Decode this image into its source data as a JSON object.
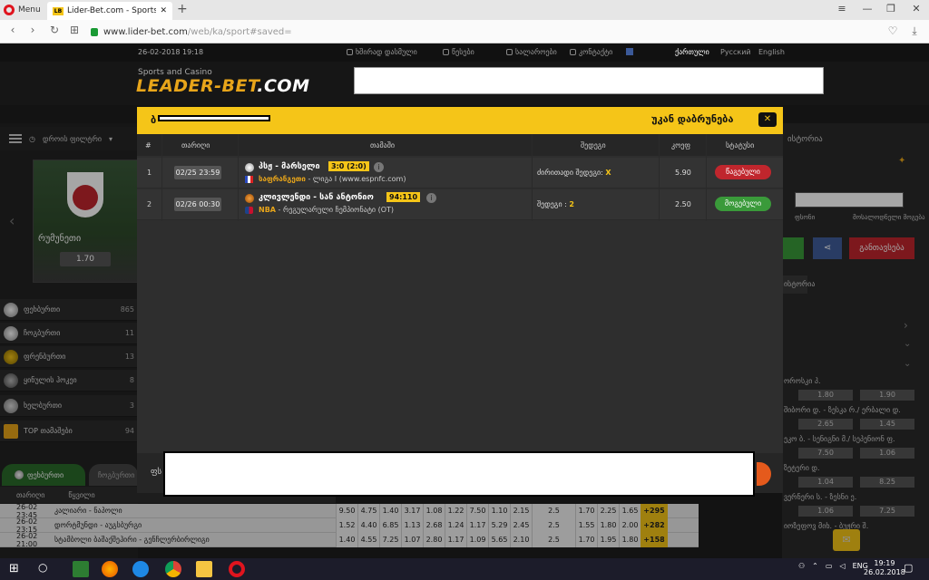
{
  "browser": {
    "menu_label": "Menu",
    "tab_title": "Lider-Bet.com - Sports an",
    "favicon": "LB",
    "url_host": "www.lider-bet.com",
    "url_path": "/web/ka/sport#saved="
  },
  "site": {
    "date": "26-02-2018 19:18",
    "toplinks": [
      "ხშირად დასმული",
      "წესები",
      "სალაროები",
      "კონტაქტი"
    ],
    "languages": [
      "ქართული",
      "Русский",
      "English"
    ],
    "sports_casino": "Sports and Casino",
    "logo_main": "LEADER-BET",
    "logo_dom": ".COM"
  },
  "left": {
    "filter_label": "დროის ფილტრი",
    "banner_team": "რუმუნეთი",
    "banner_odd": "1.70",
    "sports": [
      {
        "label": "ფეხბურთი",
        "count": "865"
      },
      {
        "label": "ჩოგბურთი",
        "count": "11"
      },
      {
        "label": "ფრენბურთი",
        "count": "13"
      },
      {
        "label": "ყინულის ჰოკეი",
        "count": "8"
      },
      {
        "label": "ხელბურთი",
        "count": "3"
      },
      {
        "label": "TOP თამაშები",
        "count": "94"
      }
    ],
    "tab_active": "ფეხბურთი",
    "tab_other": "ჩოგბურთი",
    "header_cols": [
      "თარიღი",
      "წყვილი"
    ]
  },
  "matches": [
    {
      "time": "26-02 23:45",
      "name": "კალიარი - ნაპოლი",
      "odds": [
        "9.50",
        "4.75",
        "1.40",
        "3.17",
        "1.08",
        "1.22",
        "7.50",
        "1.10",
        "2.15"
      ],
      "line": "2.5",
      "ou": [
        "1.70",
        "2.25",
        "1.65"
      ],
      "plus": "+295"
    },
    {
      "time": "26-02 23:15",
      "name": "დორტმუნდი - აუგსბურგი",
      "odds": [
        "1.52",
        "4.40",
        "6.85",
        "1.13",
        "2.68",
        "1.24",
        "1.17",
        "5.29",
        "2.45"
      ],
      "line": "2.5",
      "ou": [
        "1.55",
        "1.80",
        "2.00"
      ],
      "plus": "+282"
    },
    {
      "time": "26-02 21:00",
      "name": "სტამბოლი ბაშაქშეჰირი - გენჩლერბირლიგი",
      "odds": [
        "1.40",
        "4.55",
        "7.25",
        "1.07",
        "2.80",
        "1.17",
        "1.09",
        "5.65",
        "2.10"
      ],
      "line": "2.5",
      "ou": [
        "1.70",
        "1.95",
        "1.80"
      ],
      "plus": "+158"
    }
  ],
  "right": {
    "history_title": "ისტორია",
    "lbl1": "ფსონი",
    "lbl2": "მოსალოდნელი მოგება",
    "place_label": "განთავსება",
    "tab_label": "ისტორია",
    "rows": [
      {
        "name": "ოროსკი პ.",
        "a": "1.80",
        "b": "1.90"
      },
      {
        "name": "შიბორი დ. - ზესკა რ./ ერბალი დ.",
        "a": "2.65",
        "b": "1.45"
      },
      {
        "name": "ეკო ბ. - სენიგნი მ./ სეპენიონ ფ.",
        "a": "7.50",
        "b": "1.06"
      },
      {
        "name": "ზეტერი დ.",
        "a": "1.04",
        "b": "8.25"
      },
      {
        "name": "ვერნერი ს. - ზესნი ე.",
        "a": "1.06",
        "b": "7.25"
      },
      {
        "name": "იოზეფოვ მიხ. - ბუჟრი შ.",
        "a": "",
        "b": ""
      }
    ]
  },
  "modal": {
    "header_left": "ბ",
    "back_label": "უკან დაბრუნება",
    "columns": [
      "#",
      "თარიღი",
      "თამაში",
      "შედეგი",
      "კოეფ",
      "სტატუსი"
    ],
    "bets": [
      {
        "num": "1",
        "date": "02/25 23:59",
        "match": "პსჟ - მარსელი",
        "score": "3:0 (2:0)",
        "league_country": "საფრანგეთი",
        "league": " - ლიგა I (www.espnfc.com)",
        "selection_label": "ძირითადი შედეგი:",
        "selection": "X",
        "coef": "5.90",
        "status": "წაგებული",
        "status_color": "#c0262d",
        "ball_color": "#ffffff"
      },
      {
        "num": "2",
        "date": "02/26 00:30",
        "match": "კლივლენდი - სან ანტონიო",
        "score": "94:110",
        "league_country": "NBA",
        "league": " - რეგულარული ჩემპიონატი (OT)",
        "selection_label": "შედეგი :",
        "selection": "2",
        "coef": "2.50",
        "status": "მოგებული",
        "status_color": "#3a9a3a",
        "ball_color": "#e8821a"
      }
    ],
    "footer_label": "ფს"
  },
  "taskbar": {
    "lang": "ENG",
    "time": "19:19",
    "date": "26.02.2018"
  },
  "colors": {
    "accent": "#f5c518",
    "lost": "#c0262d",
    "won": "#3a9a3a"
  }
}
